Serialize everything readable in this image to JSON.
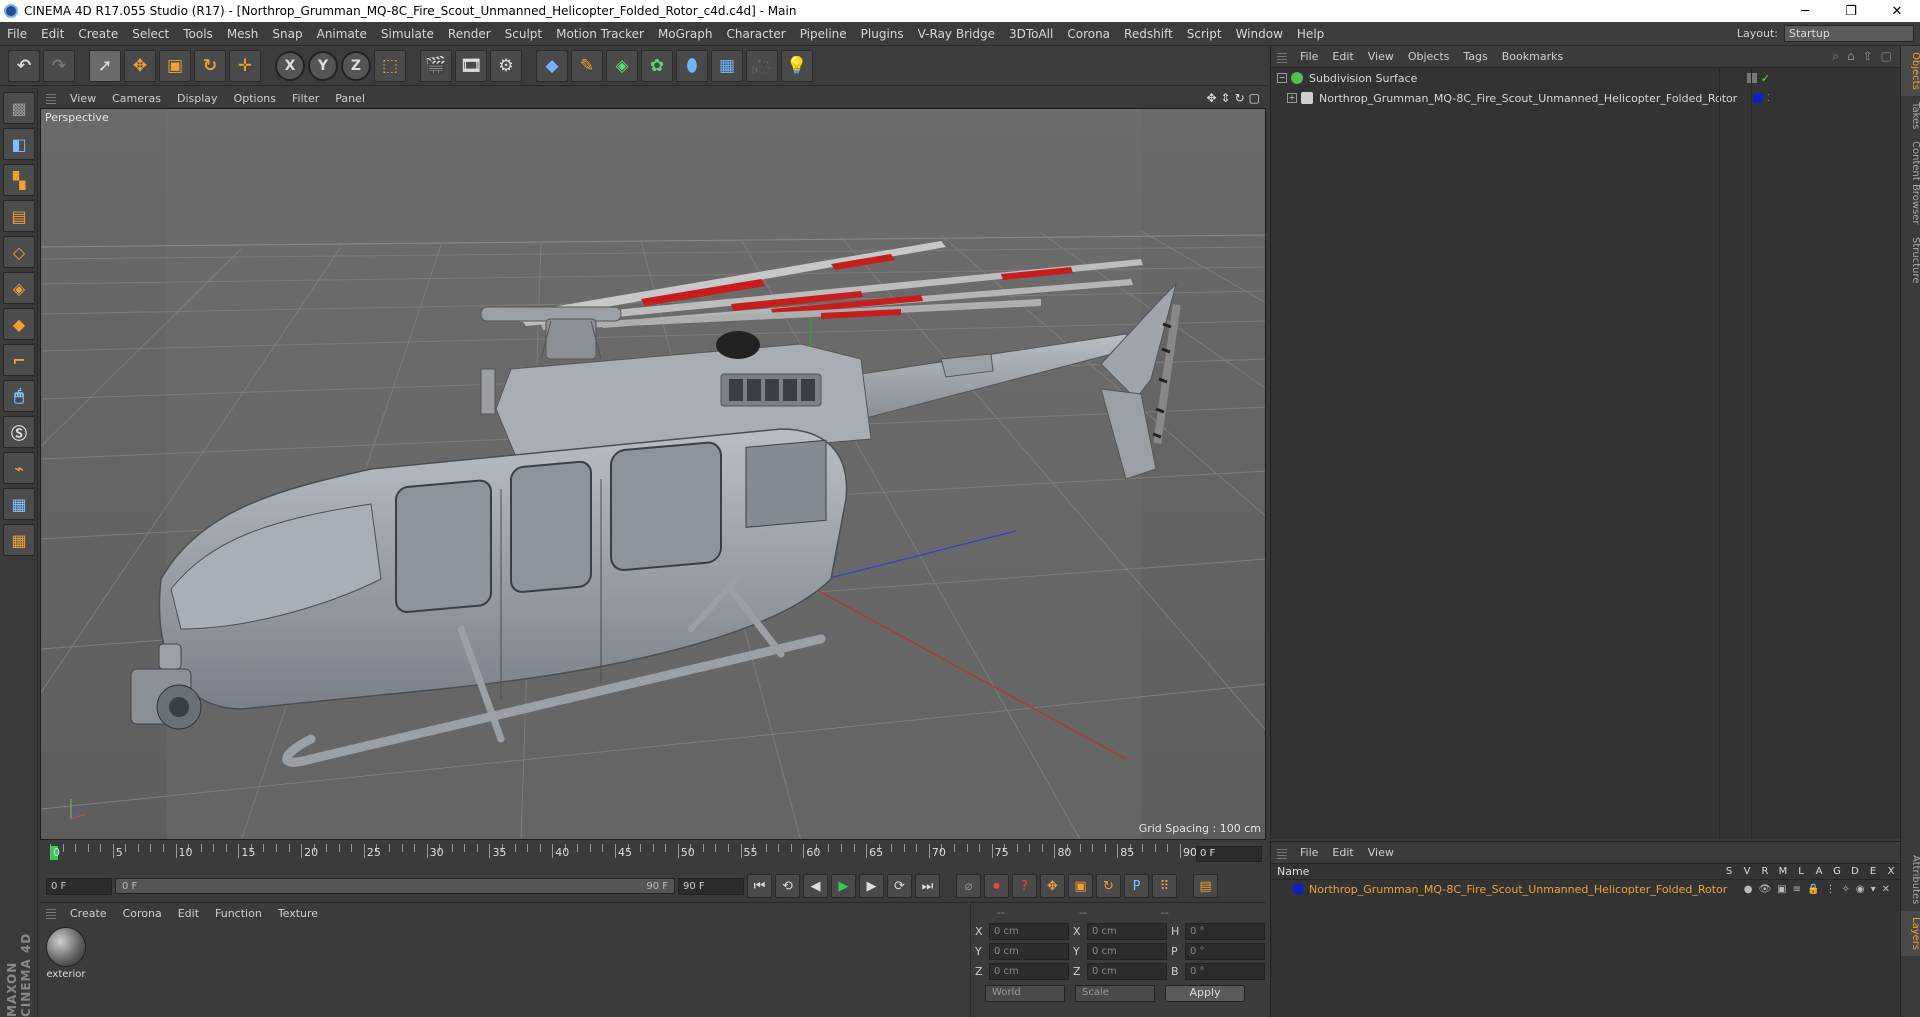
{
  "titlebar": {
    "title": "CINEMA 4D R17.055 Studio (R17) - [Northrop_Grumman_MQ-8C_Fire_Scout_Unmanned_Helicopter_Folded_Rotor_c4d.c4d] - Main",
    "minimize": "─",
    "maximize": "❐",
    "close": "✕"
  },
  "menubar": {
    "items": [
      "File",
      "Edit",
      "Create",
      "Select",
      "Tools",
      "Mesh",
      "Snap",
      "Animate",
      "Simulate",
      "Render",
      "Sculpt",
      "Motion Tracker",
      "MoGraph",
      "Character",
      "Pipeline",
      "Plugins",
      "V-Ray Bridge",
      "3DToAll",
      "Corona",
      "Redshift",
      "Script",
      "Window",
      "Help"
    ],
    "layout_label": "Layout:",
    "layout_value": "Startup"
  },
  "viewport": {
    "menu": [
      "View",
      "Cameras",
      "Display",
      "Options",
      "Filter",
      "Panel"
    ],
    "label": "Perspective",
    "grid_spacing": "Grid Spacing : 100 cm"
  },
  "timeline": {
    "ticks": [
      "0",
      "5",
      "10",
      "15",
      "20",
      "25",
      "30",
      "35",
      "40",
      "45",
      "50",
      "55",
      "60",
      "65",
      "70",
      "75",
      "80",
      "85",
      "90"
    ],
    "current_frame": "0 F"
  },
  "transport": {
    "start": "0 F",
    "range_start": "0 F",
    "range_end": "90 F",
    "end": "90 F"
  },
  "material_manager": {
    "menu": [
      "Create",
      "Corona",
      "Edit",
      "Function",
      "Texture"
    ],
    "material_name": "exterior"
  },
  "coordinates": {
    "headers": [
      "--",
      "--",
      "--"
    ],
    "rows": [
      {
        "a1": "X",
        "v1": "0 cm",
        "a2": "X",
        "v2": "0 cm",
        "a3": "H",
        "v3": "0 °"
      },
      {
        "a1": "Y",
        "v1": "0 cm",
        "a2": "Y",
        "v2": "0 cm",
        "a3": "P",
        "v3": "0 °"
      },
      {
        "a1": "Z",
        "v1": "0 cm",
        "a2": "Z",
        "v2": "0 cm",
        "a3": "B",
        "v3": "0 °"
      }
    ],
    "space": "World",
    "mode": "Scale",
    "apply": "Apply"
  },
  "object_manager": {
    "menu": [
      "File",
      "Edit",
      "View",
      "Objects",
      "Tags",
      "Bookmarks"
    ],
    "objects": [
      {
        "name": "Subdivision Surface",
        "icon_color": "#4ec24e"
      },
      {
        "name": "Northrop_Grumman_MQ-8C_Fire_Scout_Unmanned_Helicopter_Folded_Rotor",
        "icon_color": "#cfcfcf"
      }
    ]
  },
  "layer_manager": {
    "menu": [
      "File",
      "Edit",
      "View"
    ],
    "name_header": "Name",
    "columns": [
      "S",
      "V",
      "R",
      "M",
      "L",
      "A",
      "G",
      "D",
      "E",
      "X"
    ],
    "layer_name": "Northrop_Grumman_MQ-8C_Fire_Scout_Unmanned_Helicopter_Folded_Rotor",
    "layer_color": "#1020c0"
  },
  "side_tabs": [
    "Objects",
    "Takes",
    "Content Browser",
    "Structure",
    "Attributes",
    "Layers"
  ],
  "brand": "MAXON CINEMA 4D"
}
